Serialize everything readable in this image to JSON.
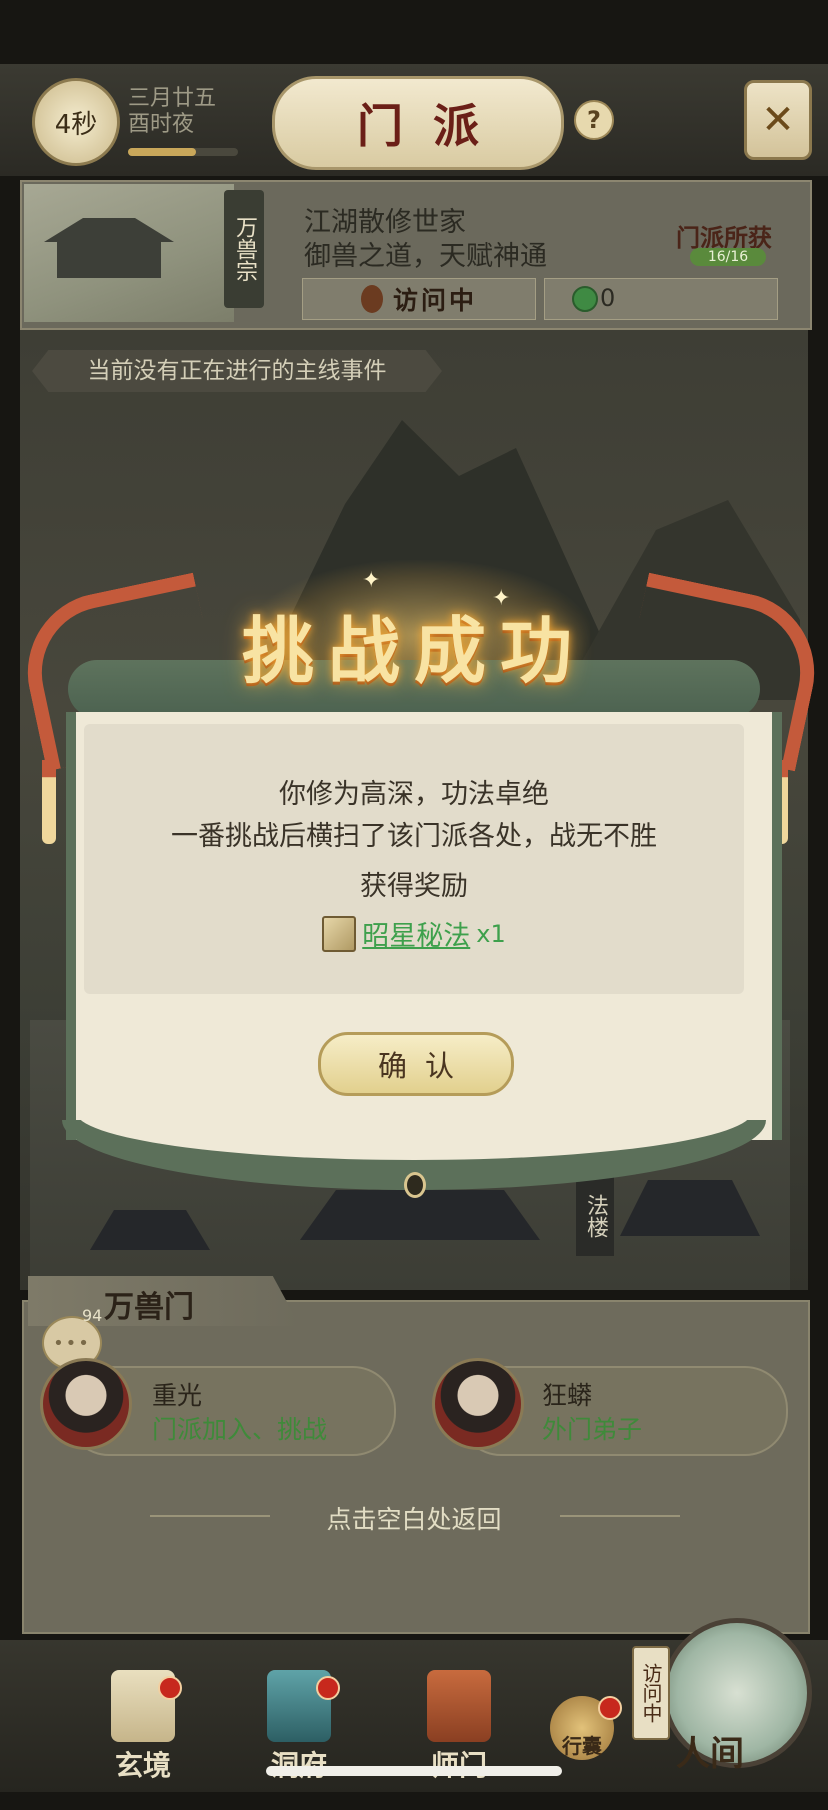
{
  "top_bar": {
    "timer": "4秒",
    "date_line1": "三月廿五",
    "date_line2": "酉时夜",
    "title": "门派",
    "help_icon": "question-icon",
    "menu_icon": "crossed-swords-icon"
  },
  "sect": {
    "tag": "万兽宗",
    "desc_line1": "江湖散修世家",
    "desc_line2": "御兽之道，天赋神通",
    "visit_label": "访问中",
    "gain_title": "门派所获",
    "gain_count": "16/16",
    "gain_value": "0"
  },
  "main_event": "当前没有正在进行的主线事件",
  "map": {
    "tower_label": "法楼"
  },
  "modal": {
    "title": "挑战成功",
    "line1": "你修为高深，功法卓绝",
    "line2": "一番挑战后横扫了该门派各处，战无不胜",
    "line3": "获得奖励",
    "reward_name": "昭星秘法",
    "reward_qty": "x1",
    "confirm_label": "确认"
  },
  "npc_panel": {
    "tab_label": "万兽门",
    "chat_count": "94",
    "npcs": [
      {
        "name": "重光",
        "role": "门派加入、挑战"
      },
      {
        "name": "狂蟒",
        "role": "外门弟子"
      }
    ],
    "return_hint": "点击空白处返回"
  },
  "nav": {
    "items": [
      {
        "label": "玄境"
      },
      {
        "label": "洞府"
      },
      {
        "label": "师门"
      },
      {
        "label": "行囊"
      }
    ],
    "world_tag": "访问中",
    "world_label": "人间"
  },
  "colors": {
    "accent_green": "#3ea04c",
    "title_gold": "#f8e3a3",
    "ribbon_red": "#c45a3b"
  }
}
